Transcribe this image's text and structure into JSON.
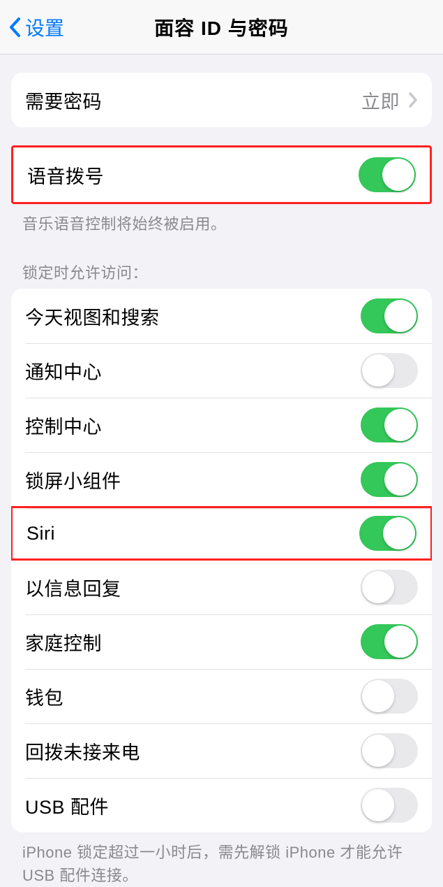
{
  "header": {
    "back_label": "设置",
    "title": "面容 ID 与密码"
  },
  "passcode_group": {
    "require_passcode": {
      "label": "需要密码",
      "value": "立即"
    }
  },
  "voice_dial": {
    "label": "语音拨号",
    "on": true,
    "footer": "音乐语音控制将始终被启用。"
  },
  "lockscreen_section": {
    "header": "锁定时允许访问：",
    "items": [
      {
        "label": "今天视图和搜索",
        "on": true,
        "highlight": false
      },
      {
        "label": "通知中心",
        "on": false,
        "highlight": false
      },
      {
        "label": "控制中心",
        "on": true,
        "highlight": false
      },
      {
        "label": "锁屏小组件",
        "on": true,
        "highlight": false
      },
      {
        "label": "Siri",
        "on": true,
        "highlight": true
      },
      {
        "label": "以信息回复",
        "on": false,
        "highlight": false
      },
      {
        "label": "家庭控制",
        "on": true,
        "highlight": false
      },
      {
        "label": "钱包",
        "on": false,
        "highlight": false
      },
      {
        "label": "回拨未接来电",
        "on": false,
        "highlight": false
      },
      {
        "label": "USB 配件",
        "on": false,
        "highlight": false
      }
    ],
    "footer": "iPhone 锁定超过一小时后，需先解锁 iPhone 才能允许USB 配件连接。"
  }
}
